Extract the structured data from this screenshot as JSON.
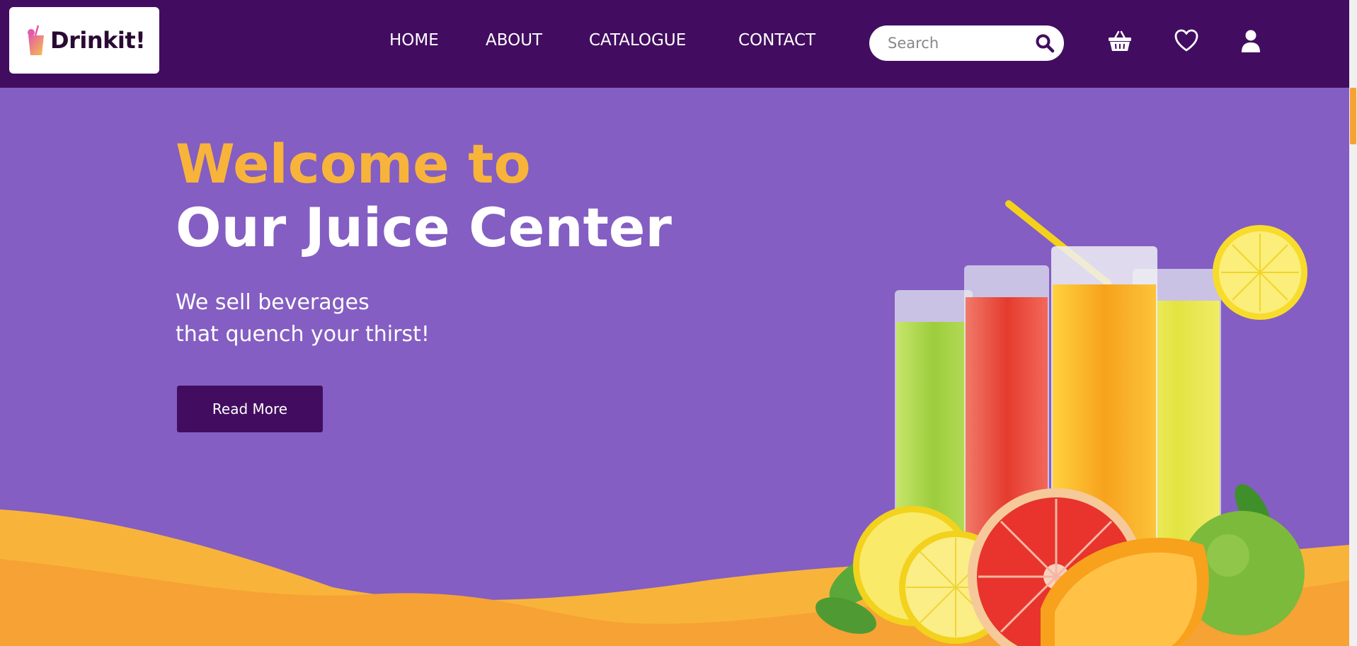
{
  "brand": {
    "name": "Drinkit!",
    "logo_icon": "juice-cup-icon"
  },
  "nav": {
    "items": [
      {
        "label": "HOME"
      },
      {
        "label": "ABOUT"
      },
      {
        "label": "CATALOGUE"
      },
      {
        "label": "CONTACT"
      }
    ]
  },
  "search": {
    "placeholder": "Search",
    "value": "",
    "icon": "search-icon"
  },
  "header_icons": [
    "basket-icon",
    "heart-icon",
    "user-icon"
  ],
  "hero": {
    "title_line1": "Welcome to",
    "title_line2": "Our Juice Center",
    "subtitle_line1": "We sell beverages",
    "subtitle_line2": "that quench your thirst!",
    "cta_label": "Read More"
  },
  "colors": {
    "nav_bg": "#420d60",
    "hero_bg": "#845ec2",
    "accent_orange": "#f8b43a",
    "wave_orange": "#f7a235",
    "button_bg": "#420d60"
  }
}
